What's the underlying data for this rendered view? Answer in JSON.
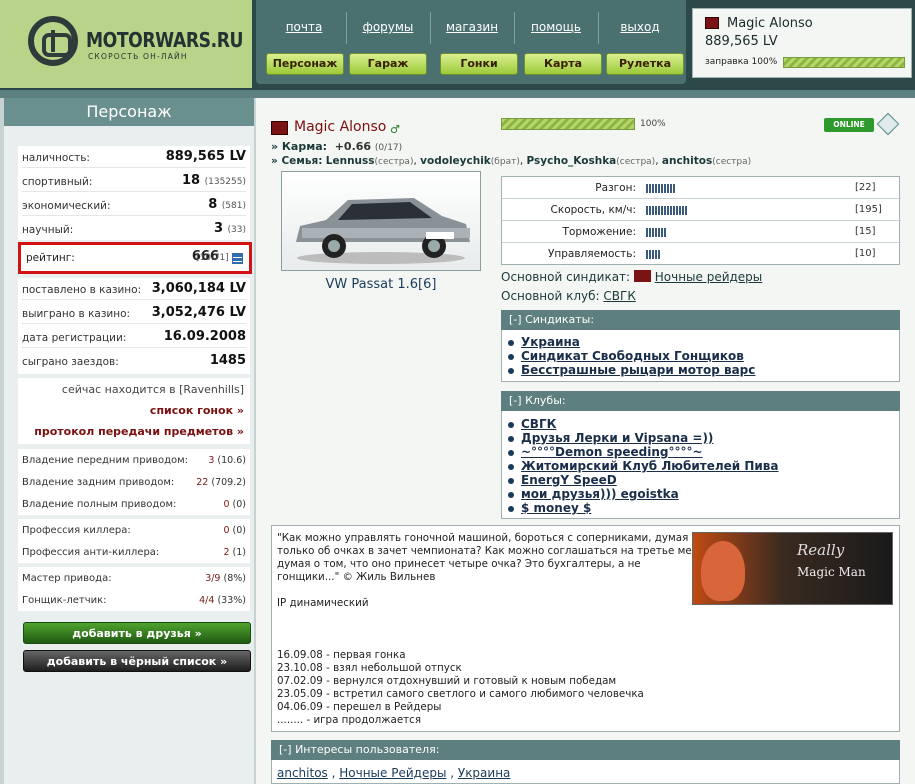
{
  "logo": {
    "title": "MOTORWARS.RU",
    "subtitle": "СКОРОСТЬ ОН-ЛАЙН"
  },
  "nav": {
    "top": [
      "почта",
      "форумы",
      "магазин",
      "помощь",
      "выход"
    ],
    "buttons": [
      "Персонаж",
      "Гараж",
      "Гонки",
      "Карта",
      "Рулетка"
    ]
  },
  "user": {
    "name": "Magic Alonso",
    "money": "889,565 LV",
    "fuel_label": "заправка 100%",
    "fuel_level": 1.0
  },
  "left": {
    "title": "Персонаж",
    "stats": [
      {
        "label": "наличность:",
        "value": "889,565 LV",
        "sub": ""
      },
      {
        "label": "спортивный:",
        "value": "18",
        "sub": "(135255)"
      },
      {
        "label": "экономический:",
        "value": "8",
        "sub": "(581)"
      },
      {
        "label": "научный:",
        "value": "3",
        "sub": "(33)"
      }
    ],
    "rating": {
      "label": "рейтинг:",
      "value": "666",
      "sub": "[10.71]"
    },
    "stats2": [
      {
        "label": "поставлено в казино:",
        "value": "3,060,184 LV"
      },
      {
        "label": "выиграно в казино:",
        "value": "3,052,476 LV"
      },
      {
        "label": "дата регистрации:",
        "value": "16.09.2008"
      },
      {
        "label": "сыграно заездов:",
        "value": "1485"
      }
    ],
    "location_prefix": "сейчас находится в",
    "location": "[Ravenhills]",
    "race_list": "список гонок »",
    "transfer_log": "протокол передачи предметов »",
    "drives": [
      {
        "label": "Владение передним приводом:",
        "value": "3",
        "sub": "(10.6)"
      },
      {
        "label": "Владение задним приводом:",
        "value": "22",
        "sub": "(709.2)"
      },
      {
        "label": "Владение полным приводом:",
        "value": "0",
        "sub": "(0)"
      }
    ],
    "professions": [
      {
        "label": "Профессия киллера:",
        "value": "0",
        "sub": "(0)"
      },
      {
        "label": "Профессия анти-киллера:",
        "value": "2",
        "sub": "(1)"
      }
    ],
    "masters": [
      {
        "label": "Мастер привода:",
        "value": "3/9",
        "sub": "(8%)"
      },
      {
        "label": "Гонщик-летчик:",
        "value": "4/4",
        "sub": "(33%)"
      }
    ],
    "add_friend": "добавить в друзья »",
    "add_black": "добавить в чёрный список »"
  },
  "profile": {
    "name": "Magic Alonso",
    "progress_label": "100%",
    "progress_level": 1.0,
    "online": "ONLINE",
    "karma_label": "» Карма:",
    "karma_value": "+0.66",
    "karma_sub": "(0/17)",
    "family_label": "» Семья:",
    "family": [
      {
        "name": "Lennuss",
        "rel": "(сестра)"
      },
      {
        "name": "vodoleychik",
        "rel": "(брат)"
      },
      {
        "name": "Psycho_Koshka",
        "rel": "(сестра)"
      },
      {
        "name": "anchitos",
        "rel": "(сестра)"
      }
    ],
    "car_name": "VW Passat 1.6[6]",
    "car_stats": [
      {
        "label": "Разгон:",
        "value": "[22]",
        "level": 22
      },
      {
        "label": "Скорость, км/ч:",
        "value": "[195]",
        "level": 30
      },
      {
        "label": "Торможение:",
        "value": "[15]",
        "level": 15
      },
      {
        "label": "Управляемость:",
        "value": "[10]",
        "level": 10
      }
    ],
    "syndicate_label": "Основной синдикат:",
    "syndicate": "Ночные рейдеры",
    "club_label": "Основной клуб:",
    "club": "СВГК"
  },
  "syndicates": {
    "header": "Синдикаты:",
    "toggle": "[-]",
    "items": [
      "Украина",
      "Синдикат Свободных Гонщиков",
      "Бесстрашные рыцари мотор варс"
    ]
  },
  "clubs": {
    "header": "Клубы:",
    "toggle": "[-]",
    "items": [
      "СВГК",
      "Друзья Лерки и Vipsana =))",
      "~°°°°Demon speeding°°°°~",
      "Житомирский Клуб Любителей Пива",
      "EnergY SpeeD",
      "мои друзья))) egoistka",
      "$ money $"
    ]
  },
  "about": {
    "quote": [
      "\"Как можно управлять гоночной машиной, бороться с соперниками, думая",
      "только об очках в зачет чемпионата? Как можно соглашаться на третье место,",
      "думая о том, что оно принесет четыре очка? Это бухгалтеры, а не",
      "гонщики...\" © Жиль Вильнев"
    ],
    "ip": "IP динамический",
    "history": [
      "16.09.08 - первая гонка",
      "23.10.08 - взял небольшой отпуск",
      "07.02.09 - вернулся отдохнувший и готовый к новым победам",
      "23.05.09 - встретил самого светлого и самого любимого человечка",
      "04.06.09 - перешел в Рейдеры",
      "........ - игра продолжается"
    ],
    "banner_line1": "Really",
    "banner_line2": "Magic Man"
  },
  "interests": {
    "header": "Интересы пользователя:",
    "toggle": "[-]",
    "items": [
      "anchitos",
      "Ночные Рейдеры",
      "Украина"
    ]
  }
}
